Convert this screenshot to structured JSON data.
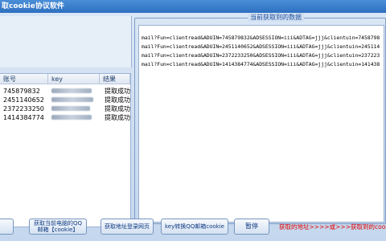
{
  "window": {
    "title": "取cookie协议软件"
  },
  "table": {
    "headers": [
      "账号",
      "key",
      "结果"
    ],
    "rows": [
      {
        "account": "745879832",
        "result": "提取成功"
      },
      {
        "account": "2451140652",
        "result": "提取成功"
      },
      {
        "account": "2372233250",
        "result": "提取成功"
      },
      {
        "account": "1414384774",
        "result": "提取成功"
      }
    ]
  },
  "output": {
    "legend": "当前获取到的数据",
    "lines": [
      "mail?Fun=clientread&ADUIN=745879832&ADSESSION=iii&ADTAG=jjj&clientuin=7458798",
      "mail?Fun=clientread&ADUIN=2451140652&ADSESSION=iii&ADTAG=jjj&clientuin=245114",
      "mail?Fun=clientread&ADUIN=2372233250&ADSESSION=iii&ADTAG=jjj&clientuin=237223",
      "mail?Fun=clientread&ADUIN=1414384774&ADSESSION=iii&ADTAG=jjj&clientuin=141438"
    ]
  },
  "buttons": {
    "left_partial": "",
    "get_cookie_line1": "获取当前电脑的QQ",
    "get_cookie_line2": "邮箱【cookie】",
    "get_login_url": "获取地址登录网页",
    "key_to_mail": "key转换QQ邮箱cookie",
    "pause": "暂停"
  },
  "status": {
    "hint": "获取的地址>>>>或>>>获取到的cookie请"
  },
  "colors": {
    "title_bar": "#2d6fc0",
    "hint_red": "#e00000",
    "button_text": "#0e3a82"
  }
}
